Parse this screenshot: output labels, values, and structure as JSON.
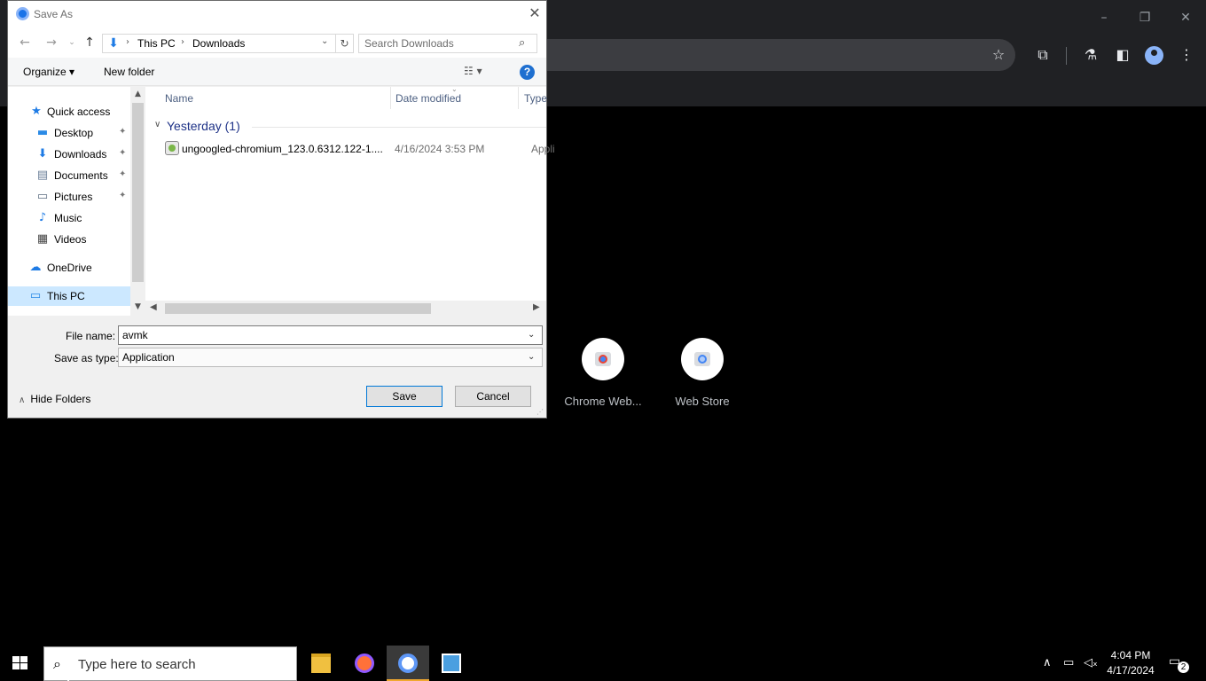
{
  "dialog": {
    "title": "Save As",
    "breadcrumb": [
      "This PC",
      "Downloads"
    ],
    "search_placeholder": "Search Downloads",
    "commands": {
      "organize": "Organize ▾",
      "new_folder": "New folder"
    },
    "nav_items": [
      {
        "label": "Quick access",
        "icon": "star-icon"
      },
      {
        "label": "Desktop",
        "icon": "desktop-icon",
        "pinned": true
      },
      {
        "label": "Downloads",
        "icon": "download-icon",
        "pinned": true
      },
      {
        "label": "Documents",
        "icon": "document-icon",
        "pinned": true
      },
      {
        "label": "Pictures",
        "icon": "pictures-icon",
        "pinned": true
      },
      {
        "label": "Music",
        "icon": "music-icon"
      },
      {
        "label": "Videos",
        "icon": "videos-icon"
      },
      {
        "label": "OneDrive",
        "icon": "cloud-icon"
      },
      {
        "label": "This PC",
        "icon": "computer-icon",
        "selected": true
      }
    ],
    "columns": [
      "Name",
      "Date modified",
      "Type"
    ],
    "group_label": "Yesterday (1)",
    "files": [
      {
        "name": "ungoogled-chromium_123.0.6312.122-1....",
        "date": "4/16/2024 3:53 PM",
        "type": "Appli"
      }
    ],
    "file_name_label": "File name:",
    "file_name_value": "avmk",
    "save_type_label": "Save as type:",
    "save_type_value": "Application",
    "hide_folders": "Hide Folders",
    "save_button": "Save",
    "cancel_button": "Cancel"
  },
  "browser": {
    "shortcuts": [
      {
        "label": "Chrome Web..."
      },
      {
        "label": "Web Store"
      }
    ]
  },
  "taskbar": {
    "search_placeholder": "Type here to search",
    "time": "4:04 PM",
    "date": "4/17/2024",
    "notification_count": "2",
    "active_accent": "#f0a830"
  }
}
